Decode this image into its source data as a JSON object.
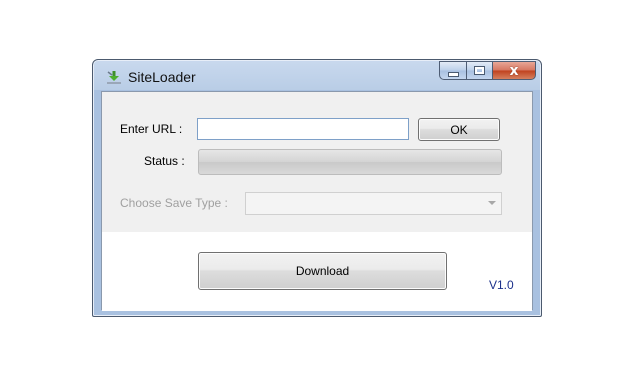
{
  "window": {
    "title": "SiteLoader",
    "close_glyph": "x"
  },
  "form": {
    "url_label": "Enter URL :",
    "url_value": "",
    "ok_label": "OK",
    "status_label": "Status :",
    "status_progress": 0,
    "save_type_label": "Choose Save Type :",
    "save_type_value": "",
    "download_label": "Download",
    "version": "V1.0"
  },
  "icons": {
    "app": "download-arrow-icon",
    "minimize": "minimize-icon",
    "maximize": "maximize-icon",
    "close": "close-icon",
    "dropdown": "chevron-down-icon"
  },
  "colors": {
    "version_text": "#1a2f8a",
    "disabled_text": "#a0a0a0",
    "close_button": "#c0411d"
  }
}
